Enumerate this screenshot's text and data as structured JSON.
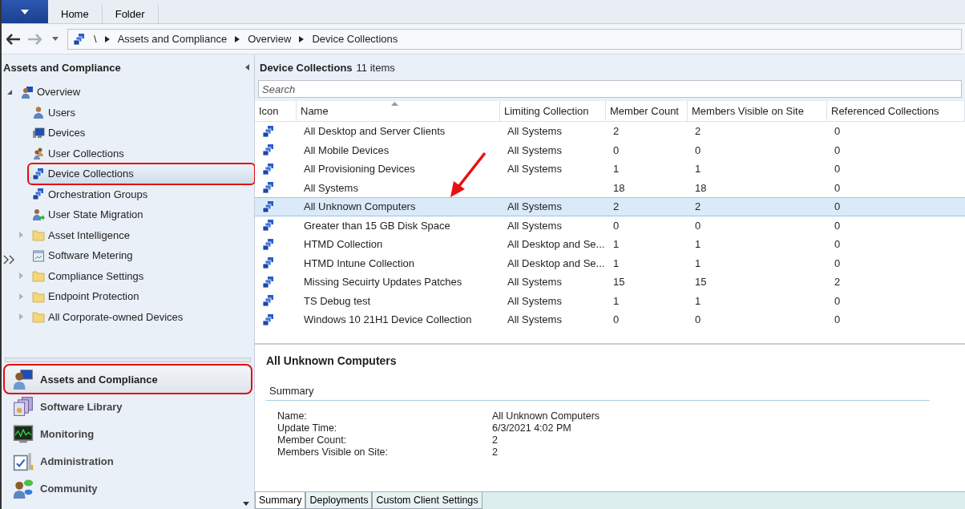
{
  "ribbon": {
    "tabs": [
      {
        "label": "Home",
        "selected": false
      },
      {
        "label": "Folder",
        "selected": false
      }
    ]
  },
  "address_bar": {
    "root": "\\",
    "path": [
      "Assets and Compliance",
      "Overview",
      "Device Collections"
    ]
  },
  "navigation": {
    "title": "Assets and Compliance",
    "tree": [
      {
        "label": "Overview",
        "kind": "overview",
        "expanded": true,
        "selected": false,
        "highlighted": false,
        "children": [
          {
            "label": "Users",
            "kind": "user",
            "selected": false,
            "highlighted": false
          },
          {
            "label": "Devices",
            "kind": "device",
            "selected": false,
            "highlighted": false
          },
          {
            "label": "User Collections",
            "kind": "usercollection",
            "selected": false,
            "highlighted": false
          },
          {
            "label": "Device Collections",
            "kind": "collection",
            "selected": true,
            "highlighted": true
          },
          {
            "label": "Orchestration Groups",
            "kind": "collection",
            "selected": false,
            "highlighted": false
          },
          {
            "label": "User State Migration",
            "kind": "migration",
            "selected": false,
            "highlighted": false
          },
          {
            "label": "Asset Intelligence",
            "kind": "folder",
            "expanded": false,
            "selected": false,
            "highlighted": false
          },
          {
            "label": "Software Metering",
            "kind": "metering",
            "selected": false,
            "highlighted": false
          },
          {
            "label": "Compliance Settings",
            "kind": "folder",
            "expanded": false,
            "selected": false,
            "highlighted": false
          },
          {
            "label": "Endpoint Protection",
            "kind": "folder",
            "expanded": false,
            "selected": false,
            "highlighted": false
          },
          {
            "label": "All Corporate-owned Devices",
            "kind": "folder",
            "expanded": false,
            "selected": false,
            "highlighted": false
          }
        ]
      }
    ],
    "workspaces": [
      {
        "label": "Assets and Compliance",
        "kind": "assets",
        "selected": true,
        "highlighted": true
      },
      {
        "label": "Software Library",
        "kind": "library",
        "selected": false,
        "highlighted": false
      },
      {
        "label": "Monitoring",
        "kind": "monitoring",
        "selected": false,
        "highlighted": false
      },
      {
        "label": "Administration",
        "kind": "administration",
        "selected": false,
        "highlighted": false
      },
      {
        "label": "Community",
        "kind": "community",
        "selected": false,
        "highlighted": false
      }
    ]
  },
  "list": {
    "title": "Device Collections",
    "count": "11 items",
    "search": {
      "placeholder": "Search"
    },
    "columns": [
      "Icon",
      "Name",
      "Limiting Collection",
      "Member Count",
      "Members Visible on Site",
      "Referenced Collections"
    ],
    "rows": [
      {
        "name": "All Desktop and Server Clients",
        "limiting": "All Systems",
        "member_count": "2",
        "visible": "2",
        "referenced": "0",
        "selected": false
      },
      {
        "name": "All Mobile Devices",
        "limiting": "All Systems",
        "member_count": "0",
        "visible": "0",
        "referenced": "0",
        "selected": false
      },
      {
        "name": "All Provisioning Devices",
        "limiting": "All Systems",
        "member_count": "1",
        "visible": "1",
        "referenced": "0",
        "selected": false
      },
      {
        "name": "All Systems",
        "member_count": "18",
        "visible": "18",
        "referenced": "0",
        "selected": false
      },
      {
        "name": "All Unknown Computers",
        "limiting": "All Systems",
        "member_count": "2",
        "visible": "2",
        "referenced": "0",
        "selected": true
      },
      {
        "name": "Greater than 15 GB Disk Space",
        "limiting": "All Systems",
        "member_count": "0",
        "visible": "0",
        "referenced": "0",
        "selected": false
      },
      {
        "name": "HTMD Collection",
        "limiting": "All Desktop and Se...",
        "member_count": "1",
        "visible": "1",
        "referenced": "0",
        "selected": false
      },
      {
        "name": "HTMD Intune Collection",
        "limiting": "All Desktop and Se...",
        "member_count": "1",
        "visible": "1",
        "referenced": "0",
        "selected": false
      },
      {
        "name": "Missing Secuirty Updates Patches",
        "limiting": "All Systems",
        "member_count": "15",
        "visible": "15",
        "referenced": "2",
        "selected": false
      },
      {
        "name": "TS Debug test",
        "limiting": "All Systems",
        "member_count": "1",
        "visible": "1",
        "referenced": "0",
        "selected": false
      },
      {
        "name": "Windows 10 21H1 Device Collection",
        "limiting": "All Systems",
        "member_count": "0",
        "visible": "0",
        "referenced": "0",
        "selected": false
      }
    ]
  },
  "details": {
    "title": "All Unknown Computers",
    "section": "Summary",
    "fields": [
      {
        "label": "Name:",
        "value": "All Unknown Computers"
      },
      {
        "label": "Update Time:",
        "value": "6/3/2021 4:02 PM"
      },
      {
        "label": "Member Count:",
        "value": "2"
      },
      {
        "label": "Members Visible on Site:",
        "value": "2"
      }
    ],
    "tabs": [
      {
        "label": "Summary",
        "selected": true
      },
      {
        "label": "Deployments",
        "selected": false
      },
      {
        "label": "Custom Client Settings",
        "selected": false
      }
    ]
  }
}
